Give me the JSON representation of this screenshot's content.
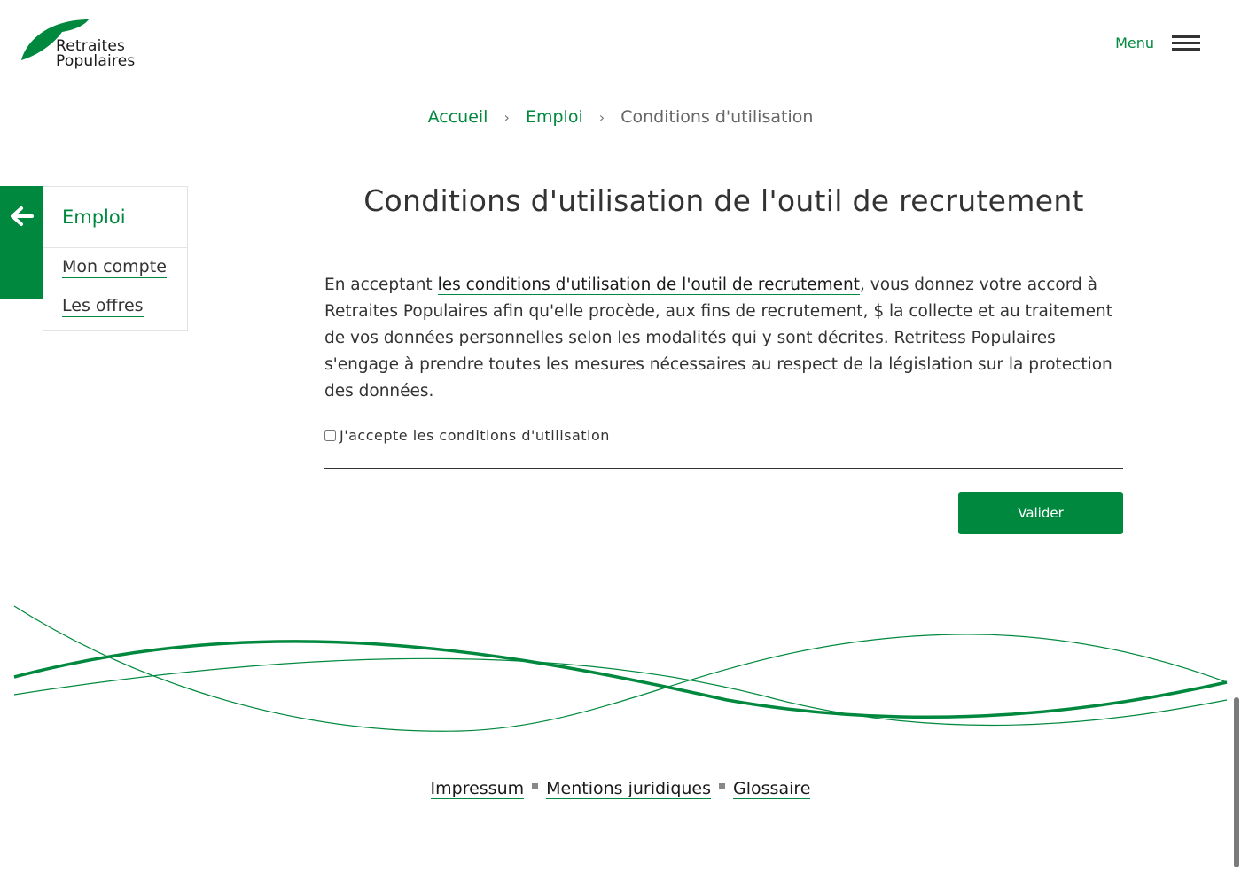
{
  "header": {
    "logo_line1": "Retraites",
    "logo_line2": "Populaires",
    "menu_label": "Menu"
  },
  "breadcrumb": {
    "items": [
      "Accueil",
      "Emploi"
    ],
    "separator": "›",
    "current": "Conditions d'utilisation"
  },
  "sidebar": {
    "title": "Emploi",
    "links": [
      "Mon compte",
      "Les offres"
    ]
  },
  "main": {
    "title": "Conditions d'utilisation de l'outil de recrutement",
    "intro_prefix": "En acceptant ",
    "intro_link": "les conditions d'utilisation de l'outil de recrutement",
    "intro_suffix": ", vous donnez votre accord à Retraites Populaires afin qu'elle procède, aux fins de recrutement, $ la collecte et au traitement de vos données personnelles selon les modalités qui y sont décrites. Retritess Populaires s'engage à prendre toutes les mesures nécessaires au respect de la législation sur la protection des données.",
    "checkbox_label": "J'accepte les conditions d'utilisation",
    "checkbox_checked": false,
    "submit_label": "Valider"
  },
  "footer": {
    "links": [
      "Impressum",
      "Mentions juridiques",
      "Glossaire"
    ]
  },
  "colors": {
    "brand_green": "#00893e",
    "text": "#333333"
  }
}
